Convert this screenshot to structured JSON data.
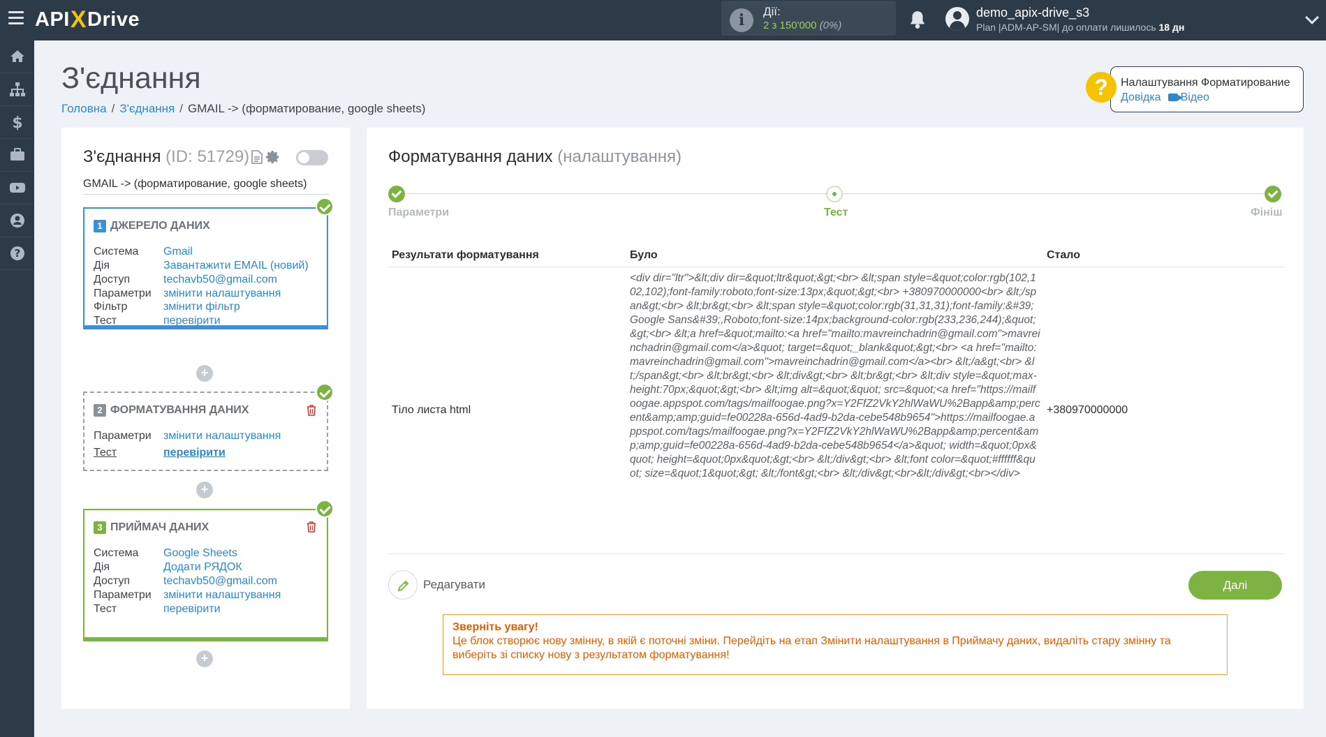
{
  "brand": {
    "logo_left": "API",
    "logo_x": "X",
    "logo_right": "Drive"
  },
  "header": {
    "actions_label": "Дії:",
    "actions_value": "2 з 150'000",
    "actions_percent": "(0%)",
    "username": "demo_apix-drive_s3",
    "plan_text": "Plan |ADM-AP-SM| до оплати лишилось",
    "plan_days": "18 дн"
  },
  "page": {
    "title": "З'єднання",
    "breadcrumb": {
      "home": "Головна",
      "connections": "З'єднання",
      "current": "GMAIL -> (форматирование, google sheets)"
    }
  },
  "help": {
    "title": "Налаштування Форматирование",
    "docs": "Довідка",
    "video": "Відео"
  },
  "connection": {
    "title": "З'єднання",
    "id_label": "(ID: 51729)",
    "name": "GMAIL -> (форматирование, google sheets)",
    "blocks": [
      {
        "num": "1",
        "title": "ДЖЕРЕЛО ДАНИХ",
        "rows": [
          {
            "k": "Система",
            "v": "Gmail"
          },
          {
            "k": "Дія",
            "v": "Завантажити EMAIL (новий)"
          },
          {
            "k": "Доступ",
            "v": "techavb50@gmail.com"
          },
          {
            "k": "Параметри",
            "v": "змінити налаштування"
          },
          {
            "k": "Фільтр",
            "v": "змінити фільтр"
          },
          {
            "k": "Тест",
            "v": "перевірити"
          }
        ]
      },
      {
        "num": "2",
        "title": "ФОРМАТУВАННЯ ДАНИХ",
        "rows": [
          {
            "k": "Параметри",
            "v": "змінити налаштування"
          },
          {
            "k": "Тест",
            "v": "перевірити"
          }
        ]
      },
      {
        "num": "3",
        "title": "ПРИЙМАЧ ДАНИХ",
        "rows": [
          {
            "k": "Система",
            "v": "Google Sheets"
          },
          {
            "k": "Дія",
            "v": "Додати РЯДОК"
          },
          {
            "k": "Доступ",
            "v": "techavb50@gmail.com"
          },
          {
            "k": "Параметри",
            "v": "змінити налаштування"
          },
          {
            "k": "Тест",
            "v": "перевірити"
          }
        ]
      }
    ],
    "plus_label": "+"
  },
  "formatting": {
    "title": "Форматування даних",
    "subtitle": "(налаштування)",
    "steps": [
      "Параметри",
      "Тест",
      "Фініш"
    ],
    "table": {
      "headers": [
        "Результати форматування",
        "Було",
        "Стало"
      ],
      "field": "Тіло листа html",
      "was": "<div dir=\"ltr\">&lt;div dir=&quot;ltr&quot;&gt;<br>  &lt;span style=&quot;color:rgb(102,102,102);font-family:roboto;font-size:13px;&quot;&gt;<br>    +380970000000<br>  &lt;/span&gt;<br>  &lt;br&gt;<br>  &lt;span style=&quot;color:rgb(31,31,31);font-family:&#39;Google Sans&#39;,Roboto;font-size:14px;background-color:rgb(233,236,244);&quot;&gt;<br>    &lt;a href=&quot;mailto:<a href=\"mailto:mavreinchadrin@gmail.com\">mavreinchadrin@gmail.com</a>&quot; target=&quot;_blank&quot;&gt;<br>      <a href=\"mailto:mavreinchadrin@gmail.com\">mavreinchadrin@gmail.com</a><br>    &lt;/a&gt;<br>  &lt;/span&gt;<br>  &lt;br&gt;<br>  &lt;div&gt;<br>    &lt;br&gt;<br>  &lt;div style=&quot;max-height:70px;&quot;&gt;<br>      &lt;img alt=&quot;&quot; src=&quot;<a href=\"https://mailfoogae.appspot.com/tags/mailfoogae.png?x=Y2FfZ2VkY2hlWaWU%2Bapp&amp;percent&amp;amp;guid=fe00228a-656d-4ad9-b2da-cebe548b9654\">https://mailfoogae.appspot.com/tags/mailfoogae.png?x=Y2FfZ2VkY2hlWaWU%2Bapp&amp;percent&amp;amp;guid=fe00228a-656d-4ad9-b2da-cebe548b9654</a>&quot; width=&quot;0px&quot; height=&quot;0px&quot;&gt;<br>    &lt;/div&gt;<br>    &lt;font color=&quot;#ffffff&quot; size=&quot;1&quot;&gt; &lt;/font&gt;<br>  &lt;/div&gt;<br>&lt;/div&gt;<br></div>",
      "now": "+380970000000"
    },
    "edit_label": "Редагувати",
    "next_label": "Далі",
    "notice_title": "Зверніть увагу!",
    "notice_body": "Це блок створює нову змінну, в якій є поточні зміни. Перейдіть на етап Змінити налаштування в Приймачу даних, видаліть стару змінну та виберіть зі списку нову з результатом форматування!"
  },
  "colors": {
    "accent_green": "#7cb342",
    "link_blue": "#2f87c9",
    "topbar": "#2d3a48",
    "notice_orange": "#e65c00"
  }
}
